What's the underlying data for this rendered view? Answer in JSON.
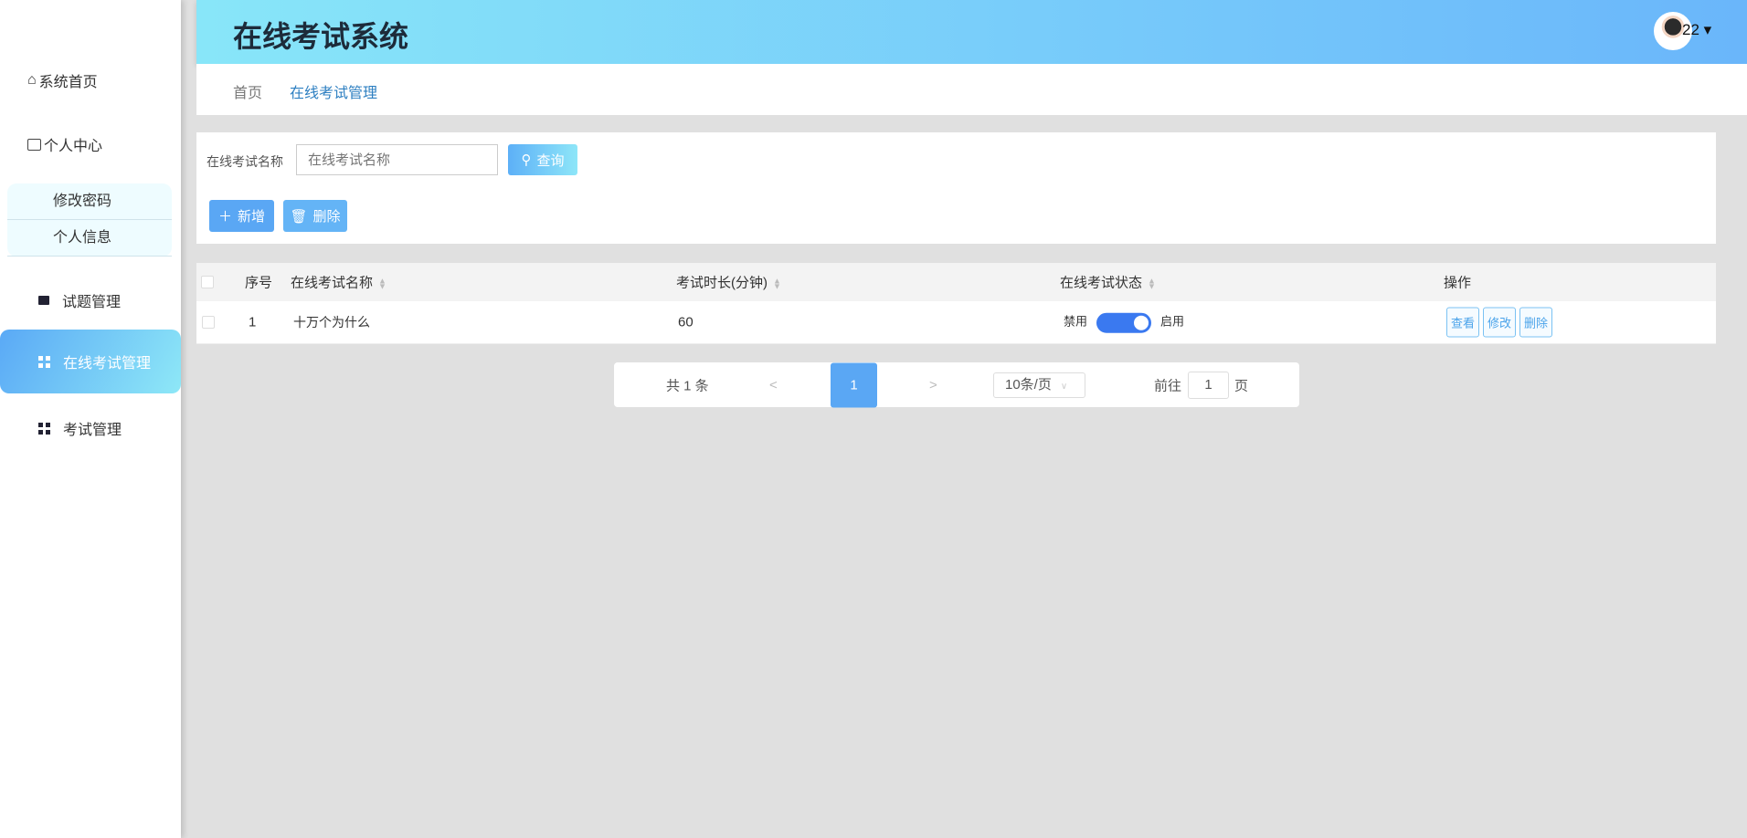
{
  "sidebar": {
    "items": [
      {
        "label": "系统首页",
        "icon": "home-icon"
      },
      {
        "label": "个人中心",
        "icon": "wallet-icon"
      },
      {
        "label": "修改密码"
      },
      {
        "label": "个人信息"
      },
      {
        "label": "试题管理",
        "icon": "wallet-icon"
      },
      {
        "label": "在线考试管理",
        "icon": "grid-icon"
      },
      {
        "label": "考试管理",
        "icon": "grid-icon"
      }
    ]
  },
  "header": {
    "title": "在线考试系统",
    "user": "22 ▾"
  },
  "breadcrumb": [
    "首页",
    "在线考试管理"
  ],
  "search": {
    "label": "在线考试名称",
    "placeholder": "在线考试名称",
    "query": "查询",
    "add": "新增",
    "delete": "删除"
  },
  "table": {
    "headers": [
      "序号",
      "在线考试名称",
      "考试时长(分钟)",
      "在线考试状态",
      "操作"
    ],
    "rows": [
      {
        "index": "1",
        "name": "十万个为什么",
        "duration": "60",
        "off": "禁用",
        "on": "启用",
        "enabled": true,
        "view": "查看",
        "edit": "修改",
        "delete": "删除"
      }
    ]
  },
  "pagination": {
    "total": "共 1 条",
    "prev": "<",
    "page": "1",
    "next": ">",
    "size": "10条/页",
    "goto": "前往",
    "goto_value": "1",
    "page_unit": "页"
  }
}
